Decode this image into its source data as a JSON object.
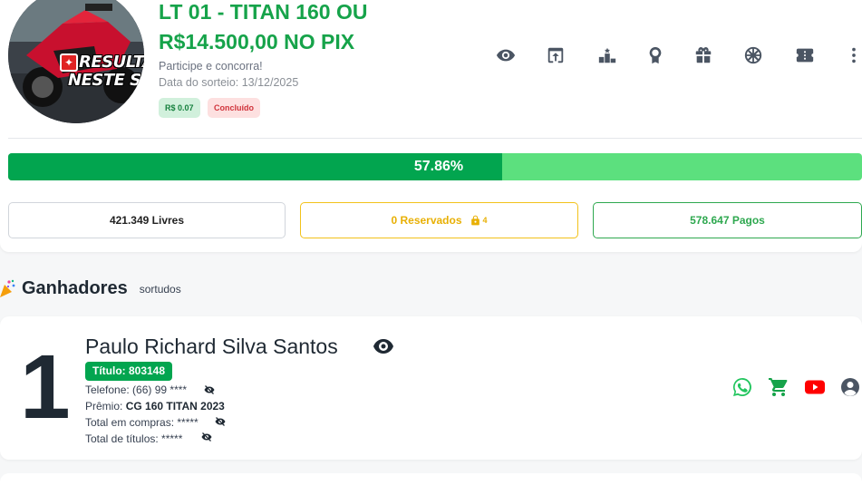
{
  "raffle": {
    "title": "LT 01 - TITAN 160 OU R$14.500,00 NO PIX",
    "subtitle": "Participe e concorra!",
    "draw_date": "Data do sorteio: 13/12/2025",
    "price_tag": "R$ 0.07",
    "status_tag": "Concluído",
    "image_badge_line1": "RESULTADO",
    "image_badge_line2": "NESTE SABADO"
  },
  "toolbar": {
    "icons": [
      "eye-icon",
      "share-icon",
      "podium-icon",
      "award-icon",
      "gift-icon",
      "wheel-icon",
      "ticket-icon",
      "more-vert-icon"
    ]
  },
  "progress": {
    "percent": 57.86,
    "label": "57.86%"
  },
  "stats": {
    "free": "421.349 Livres",
    "reserved": "0 Reservados",
    "reserved_lock_count": "4",
    "paid": "578.647 Pagos"
  },
  "winners": {
    "heading": "Ganhadores",
    "sub": "sortudos",
    "items": [
      {
        "rank": "1",
        "name": "Paulo Richard Silva Santos",
        "ticket": "Título: 803148",
        "phone": "Telefone: (66) 99 ****",
        "prize_label": "Prêmio:",
        "prize": "CG 160 TITAN 2023",
        "purchases": "Total em compras: *****",
        "titles": "Total de títulos: *****"
      }
    ]
  },
  "colors": {
    "brand_green": "#02a54f",
    "progress_bg": "#5ce07e",
    "title_green": "#16a34a",
    "reserved_yellow": "#f2c21a",
    "youtube_red": "#ff0000"
  }
}
